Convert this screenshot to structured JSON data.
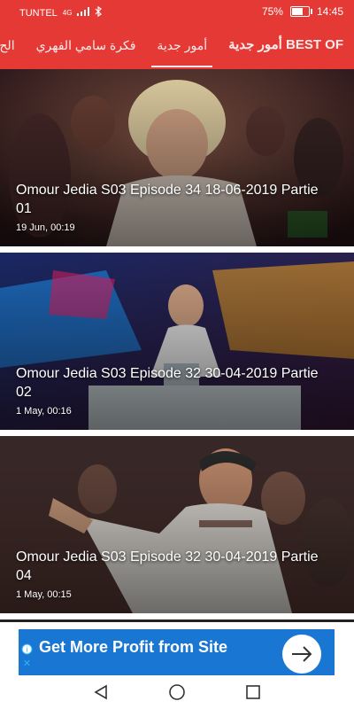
{
  "status_bar": {
    "carrier": "TUNTEL",
    "network": "4G",
    "battery_percent": "75%",
    "battery_level": 0.75,
    "time": "14:45"
  },
  "tabs": [
    {
      "label": "أمور جدية BEST OF",
      "active": false
    },
    {
      "label": "أمور جدية",
      "active": true
    },
    {
      "label": "فكرة سامي الفهري",
      "active": false
    },
    {
      "label": "(الح",
      "active": false
    }
  ],
  "videos": [
    {
      "title": "Omour Jedia S03 Episode 34 18-06-2019 Partie 01",
      "date": "19 Jun, 00:19"
    },
    {
      "title": "Omour Jedia S03 Episode 32 30-04-2019 Partie 02",
      "date": "1 May, 00:16"
    },
    {
      "title": "Omour Jedia S03 Episode 32 30-04-2019 Partie 04",
      "date": "1 May, 00:15"
    }
  ],
  "ad": {
    "text": "Get More Profit from Site",
    "brand_color": "#1976d2"
  },
  "colors": {
    "app_bar": "#e53935"
  }
}
